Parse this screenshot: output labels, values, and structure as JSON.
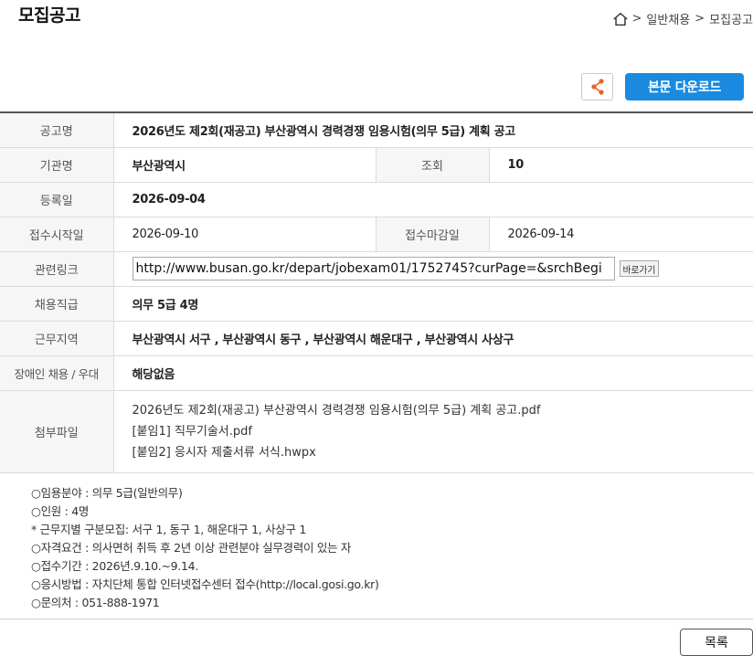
{
  "page": {
    "title": "모집공고",
    "breadcrumb": [
      ">",
      "일반채용",
      ">",
      "모집공고"
    ]
  },
  "toolbar": {
    "share_icon": "share-icon",
    "download_label": "본문 다운로드"
  },
  "details": {
    "title_label": "공고명",
    "title_value": "2026년도 제2회(재공고) 부산광역시 경력경쟁 임용시험(의무 5급) 계획 공고",
    "agency_label": "기관명",
    "agency_value": "부산광역시",
    "views_label": "조회",
    "views_value": "10",
    "registered_label": "등록일",
    "registered_value": "2026-09-04",
    "start_label": "접수시작일",
    "start_value": "2026-09-10",
    "end_label": "접수마감일",
    "end_value": "2026-09-14",
    "link_label": "관련링크",
    "link_value": "http://www.busan.go.kr/depart/jobexam01/1752745?curPage=&srchBegi",
    "link_button": "바로가기",
    "position_label": "채용직급",
    "position_value": "의무 5급 4명",
    "region_label": "근무지역",
    "region_value": "부산광역시 서구 , 부산광역시 동구 , 부산광역시 해운대구 , 부산광역시 사상구",
    "disabled_label": "장애인 채용 / 우대",
    "disabled_value": "해당없음",
    "files_label": "첨부파일",
    "files": [
      "2026년도 제2회(재공고) 부산광역시 경력경쟁 임용시험(의무 5급) 계획 공고.pdf",
      "[붙임1] 직무기술서.pdf",
      "[붙임2] 응시자 제출서류 서식.hwpx"
    ]
  },
  "notes": [
    "○임용분야 : 의무 5급(일반의무)",
    "○인원 : 4명",
    "* 근무지별 구분모집: 서구 1, 동구 1, 해운대구 1, 사상구 1",
    "○자격요건 : 의사면허 취득 후 2년 이상 관련분야 실무경력이 있는 자",
    "○접수기간 : 2026년.9.10.~9.14.",
    "○응시방법 : 자치단체 통합 인터넷접수센터 접수(http://local.gosi.go.kr)",
    "○문의처 : 051-888-1971"
  ],
  "footer": {
    "list_label": "목록"
  },
  "colors": {
    "accent": "#1a8ae0",
    "share_icon": "#e8622b"
  }
}
